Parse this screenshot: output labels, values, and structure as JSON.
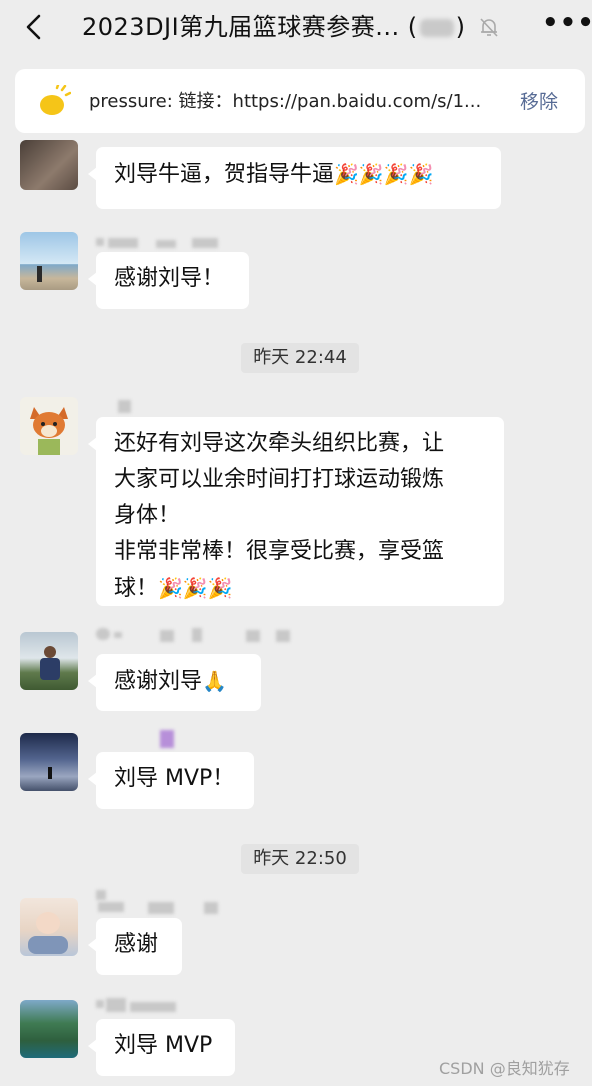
{
  "header": {
    "title": "2023DJI第九届篮球赛参赛...",
    "count_open": "(",
    "count_close": ")",
    "more_label": "•••"
  },
  "pinned": {
    "text": "pressure: 链接：https://pan.baidu.com/s/1...",
    "remove_label": "移除"
  },
  "messages": [
    {
      "text_lines": [
        "刘导牛逼，贺指导牛逼"
      ],
      "emoji": "🎉🎉🎉🎉"
    },
    {
      "text_lines": [
        "感谢刘导！"
      ]
    },
    {
      "text_lines": [
        "还好有刘导这次牵头组织比赛，让",
        "大家可以业余时间打打球运动锻炼",
        "身体！",
        "非常非常棒！很享受比赛，享受篮",
        "球！"
      ],
      "emoji": "🎉🎉🎉"
    },
    {
      "text_lines": [
        "感谢刘导"
      ],
      "emoji": "🙏"
    },
    {
      "text_lines": [
        "刘导 MVP！"
      ]
    },
    {
      "text_lines": [
        "感谢"
      ]
    },
    {
      "text_lines": [
        "刘导 MVP"
      ]
    }
  ],
  "times": [
    "昨天 22:44",
    "昨天 22:50"
  ],
  "watermark": "CSDN @良知犹存",
  "colors": {
    "background": "#ededed",
    "link": "#576b95",
    "pin_icon": "#f5c518"
  }
}
